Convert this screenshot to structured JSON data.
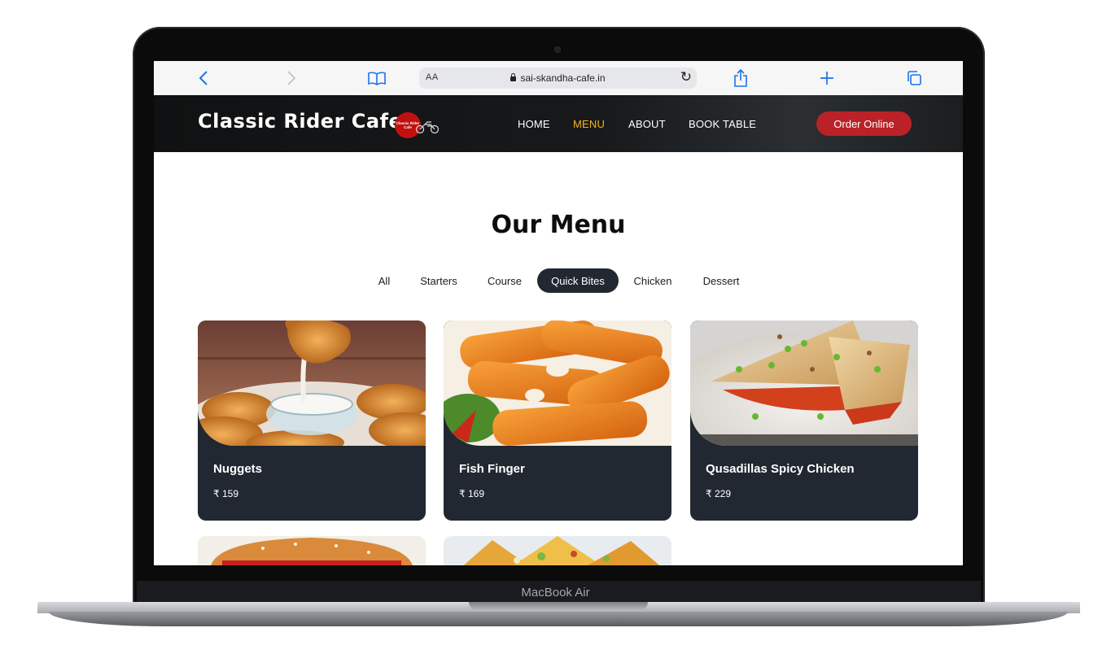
{
  "browser": {
    "aa_label": "AA",
    "url": "sai-skandha-cafe.in"
  },
  "header": {
    "brand": "Classic Rider Cafe",
    "logo_text": "Classic Rider Cafe",
    "nav": [
      "HOME",
      "MENU",
      "ABOUT",
      "BOOK TABLE"
    ],
    "active_nav": "MENU",
    "order_button": "Order Online"
  },
  "menu": {
    "title": "Our Menu",
    "filters": [
      "All",
      "Starters",
      "Course",
      "Quick Bites",
      "Chicken",
      "Dessert"
    ],
    "active_filter": "Quick Bites",
    "items": [
      {
        "name": "Nuggets",
        "price": "₹ 159"
      },
      {
        "name": "Fish Finger",
        "price": "₹ 169"
      },
      {
        "name": "Qusadillas Spicy Chicken",
        "price": "₹ 229"
      }
    ]
  },
  "device": {
    "label": "MacBook Air"
  },
  "colors": {
    "card_bg": "#222831",
    "active_nav": "#f0b420",
    "order_button": "#ba2228",
    "safari_accent": "#1a73e8"
  }
}
